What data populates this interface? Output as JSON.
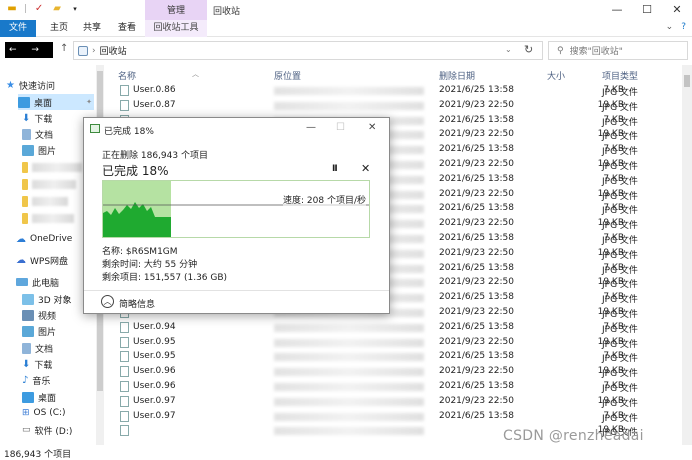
{
  "titlebar": {
    "context_tab": "管理",
    "title": "回收站",
    "controls": [
      "—",
      "☐",
      "✕"
    ]
  },
  "ribbon": {
    "tabs": [
      "文件",
      "主页",
      "共享",
      "查看",
      "回收站工具"
    ],
    "right": [
      "⌄",
      "?"
    ]
  },
  "address": {
    "nav": "← →",
    "path": "回收站",
    "search_placeholder": "搜索\"回收站\""
  },
  "sidebar": {
    "items": [
      {
        "label": "快速访问",
        "icon": "star-icon"
      },
      {
        "label": "桌面",
        "icon": "desktop-icon"
      },
      {
        "label": "下载",
        "icon": "download-icon"
      },
      {
        "label": "文档",
        "icon": "document-icon"
      },
      {
        "label": "图片",
        "icon": "picture-icon"
      },
      {
        "label": "",
        "icon": "folder-icon"
      },
      {
        "label": "",
        "icon": "folder-icon"
      },
      {
        "label": "",
        "icon": "folder-icon"
      },
      {
        "label": "",
        "icon": "folder-icon"
      },
      {
        "label": "OneDrive",
        "icon": "cloud-icon"
      },
      {
        "label": "WPS网盘",
        "icon": "cloud-icon"
      },
      {
        "label": "此电脑",
        "icon": "computer-icon"
      },
      {
        "label": "3D 对象",
        "icon": "cube-icon"
      },
      {
        "label": "视频",
        "icon": "video-icon"
      },
      {
        "label": "图片",
        "icon": "picture-icon"
      },
      {
        "label": "文档",
        "icon": "document-icon"
      },
      {
        "label": "下载",
        "icon": "download-icon"
      },
      {
        "label": "音乐",
        "icon": "music-icon"
      },
      {
        "label": "桌面",
        "icon": "desktop-icon"
      },
      {
        "label": "OS (C:)",
        "icon": "drive-icon"
      },
      {
        "label": "软件 (D:)",
        "icon": "drive-icon"
      }
    ]
  },
  "list": {
    "columns": [
      "名称",
      "原位置",
      "删除日期",
      "大小",
      "项目类型"
    ],
    "rows": [
      {
        "name": "User.0.86",
        "date": "2021/6/25 13:58",
        "size": "7 KB",
        "type": "JPG 文件"
      },
      {
        "name": "User.0.87",
        "date": "2021/9/23 22:50",
        "size": "19 KB",
        "type": "JPG 文件"
      },
      {
        "name": "",
        "date": "2021/6/25 13:58",
        "size": "7 KB",
        "type": "JPG 文件"
      },
      {
        "name": "",
        "date": "2021/9/23 22:50",
        "size": "19 KB",
        "type": "JPG 文件"
      },
      {
        "name": "",
        "date": "2021/6/25 13:58",
        "size": "7 KB",
        "type": "JPG 文件"
      },
      {
        "name": "",
        "date": "2021/9/23 22:50",
        "size": "19 KB",
        "type": "JPG 文件"
      },
      {
        "name": "",
        "date": "2021/6/25 13:58",
        "size": "7 KB",
        "type": "JPG 文件"
      },
      {
        "name": "",
        "date": "2021/9/23 22:50",
        "size": "19 KB",
        "type": "JPG 文件"
      },
      {
        "name": "",
        "date": "2021/6/25 13:58",
        "size": "7 KB",
        "type": "JPG 文件"
      },
      {
        "name": "",
        "date": "2021/9/23 22:50",
        "size": "19 KB",
        "type": "JPG 文件"
      },
      {
        "name": "",
        "date": "2021/6/25 13:58",
        "size": "7 KB",
        "type": "JPG 文件"
      },
      {
        "name": "",
        "date": "2021/9/23 22:50",
        "size": "19 KB",
        "type": "JPG 文件"
      },
      {
        "name": "",
        "date": "2021/6/25 13:58",
        "size": "7 KB",
        "type": "JPG 文件"
      },
      {
        "name": "",
        "date": "2021/9/23 22:50",
        "size": "19 KB",
        "type": "JPG 文件"
      },
      {
        "name": "",
        "date": "2021/6/25 13:58",
        "size": "7 KB",
        "type": "JPG 文件"
      },
      {
        "name": "User.0.94",
        "date": "2021/9/23 22:50",
        "size": "19 KB",
        "type": "JPG 文件"
      },
      {
        "name": "User.0.94",
        "date": "2021/6/25 13:58",
        "size": "7 KB",
        "type": "JPG 文件"
      },
      {
        "name": "User.0.95",
        "date": "2021/9/23 22:50",
        "size": "19 KB",
        "type": "JPG 文件"
      },
      {
        "name": "User.0.95",
        "date": "2021/6/25 13:58",
        "size": "7 KB",
        "type": "JPG 文件"
      },
      {
        "name": "User.0.96",
        "date": "2021/9/23 22:50",
        "size": "19 KB",
        "type": "JPG 文件"
      },
      {
        "name": "User.0.96",
        "date": "2021/6/25 13:58",
        "size": "7 KB",
        "type": "JPG 文件"
      },
      {
        "name": "User.0.97",
        "date": "2021/9/23 22:50",
        "size": "19 KB",
        "type": "JPG 文件"
      },
      {
        "name": "User.0.97",
        "date": "2021/6/25 13:58",
        "size": "7 KB",
        "type": "JPG 文件"
      },
      {
        "name": "",
        "date": "",
        "size": "19 KB",
        "type": "JPG 文件"
      }
    ]
  },
  "status": {
    "count": "186,943 个项目",
    "watermark": "CSDN @renzheadai"
  },
  "dialog": {
    "title": "已完成 18%",
    "deleting": "正在删除 186,943 个项目",
    "percent_text": "已完成 18%",
    "percent": 18,
    "speed": "速度: 208 个项目/秒",
    "name_line": "名称: $R6SM1GM",
    "time_line": "剩余时间: 大约 55 分钟",
    "remain_line": "剩余项目: 151,557 (1.36 GB)",
    "details": "简略信息",
    "colors": {
      "fill": "#b5e2a2",
      "wave": "#1faa30",
      "border": "#a7d699"
    }
  }
}
